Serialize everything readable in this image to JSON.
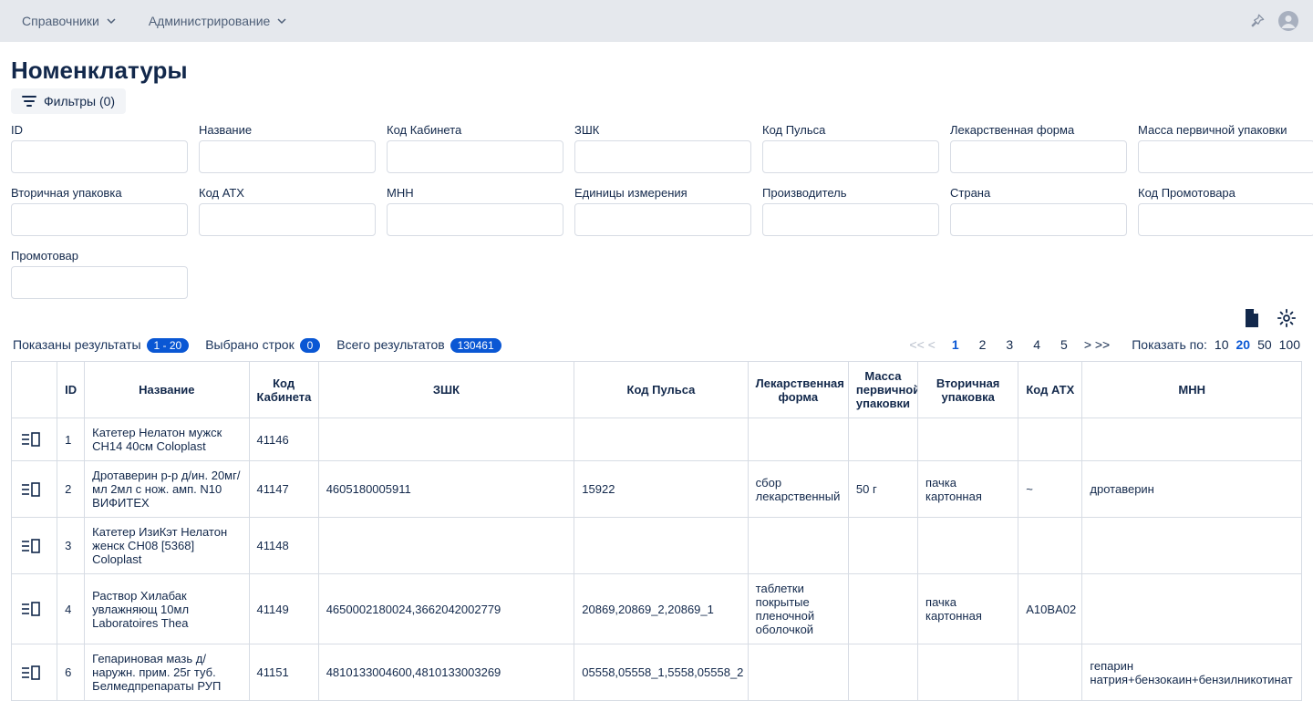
{
  "topbar": {
    "menu": [
      {
        "label": "Справочники"
      },
      {
        "label": "Администрирование"
      }
    ]
  },
  "page": {
    "title": "Номенклатуры",
    "filters_label": "Фильтры (0)"
  },
  "filters": [
    {
      "label": "ID"
    },
    {
      "label": "Название"
    },
    {
      "label": "Код Кабинета"
    },
    {
      "label": "ЗШК"
    },
    {
      "label": "Код Пульса"
    },
    {
      "label": "Лекарственная форма"
    },
    {
      "label": "Масса первичной упаковки"
    },
    {
      "label": "Вторичная упаковка"
    },
    {
      "label": "Код АТХ"
    },
    {
      "label": "МНН"
    },
    {
      "label": "Единицы измерения"
    },
    {
      "label": "Производитель"
    },
    {
      "label": "Страна"
    },
    {
      "label": "Код Промотовара"
    },
    {
      "label": "Промотовар"
    }
  ],
  "status": {
    "shown_label": "Показаны результаты",
    "shown_range": "1 - 20",
    "selected_label": "Выбрано строк",
    "selected_count": "0",
    "total_label": "Всего результатов",
    "total_count": "130461"
  },
  "pager": {
    "prev_first": "<< <",
    "pages": [
      "1",
      "2",
      "3",
      "4",
      "5"
    ],
    "next_last": ">  >>",
    "perpage_label": "Показать по:",
    "perpage_options": [
      "10",
      "20",
      "50",
      "100"
    ],
    "perpage_active": "20",
    "active_page": "1"
  },
  "table": {
    "headers": [
      "",
      "ID",
      "Название",
      "Код Кабинета",
      "ЗШК",
      "Код Пульса",
      "Лекарственная форма",
      "Масса первичной упаковки",
      "Вторичная упаковка",
      "Код АТХ",
      "МНН"
    ],
    "rows": [
      {
        "id": "1",
        "name": "Катетер Нелатон мужск CH14 40см Coloplast",
        "kab": "41146",
        "zshk": "",
        "pulse": "",
        "form": "",
        "mass": "",
        "pack": "",
        "atx": "",
        "mnn": ""
      },
      {
        "id": "2",
        "name": "Дротаверин р-р д/ин. 20мг/мл 2мл с нож. амп. N10 ВИФИТЕХ",
        "kab": "41147",
        "zshk": "4605180005911",
        "pulse": "15922",
        "form": "сбор лекарственный",
        "mass": "50 г",
        "pack": "пачка картонная",
        "atx": "~",
        "mnn": "дротаверин"
      },
      {
        "id": "3",
        "name": "Катетер ИзиКэт Нелатон женск CH08 [5368] Coloplast",
        "kab": "41148",
        "zshk": "",
        "pulse": "",
        "form": "",
        "mass": "",
        "pack": "",
        "atx": "",
        "mnn": ""
      },
      {
        "id": "4",
        "name": "Раствор Хилабак увлажняющ 10мл Laboratoires Thea",
        "kab": "41149",
        "zshk": "4650002180024,3662042002779",
        "pulse": "20869,20869_2,20869_1",
        "form": "таблетки покрытые пленочной оболочкой",
        "mass": "",
        "pack": "пачка картонная",
        "atx": "A10BA02",
        "mnn": ""
      },
      {
        "id": "6",
        "name": "Гепариновая мазь д/наружн. прим. 25г туб. Белмедпрепараты РУП",
        "kab": "41151",
        "zshk": "4810133004600,4810133003269",
        "pulse": "05558,05558_1,5558,05558_2",
        "form": "",
        "mass": "",
        "pack": "",
        "atx": "",
        "mnn": "гепарин натрия+бензокаин+бензилникотинат"
      }
    ]
  }
}
